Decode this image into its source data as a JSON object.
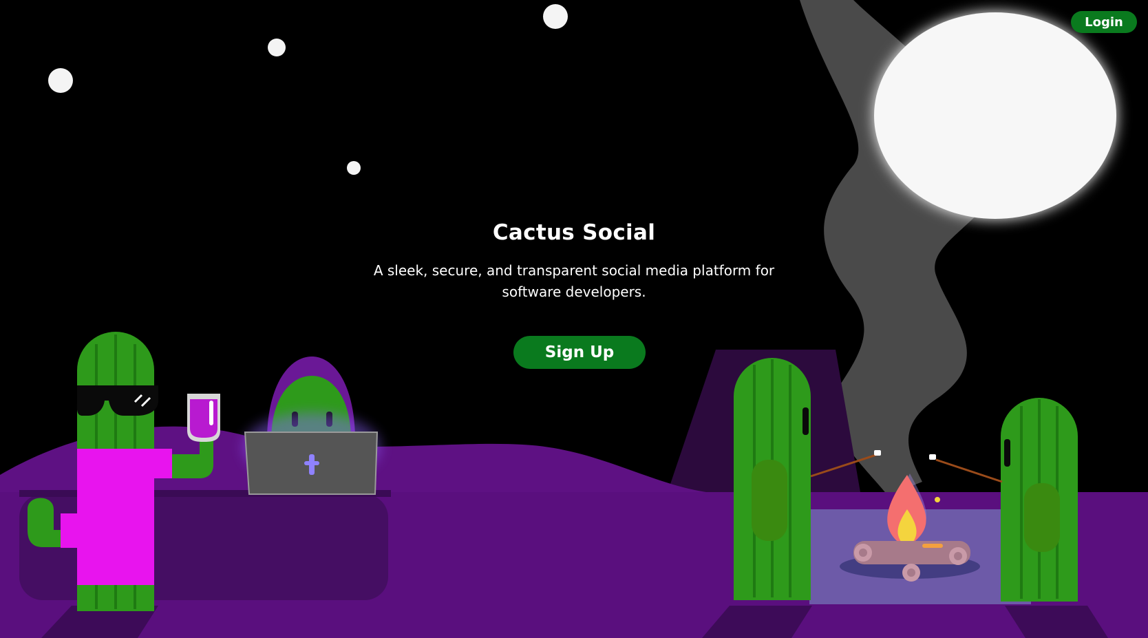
{
  "header": {
    "login_label": "Login"
  },
  "hero": {
    "title": "Cactus Social",
    "subtitle": "A sleek, secure, and transparent social media platform for software developers.",
    "signup_label": "Sign Up"
  },
  "colors": {
    "background": "#000000",
    "ground": "#5e1183",
    "ground_dark": "#450e63",
    "accent_green": "#0a7a1e",
    "cactus_green": "#2e9a1b",
    "shirt_pink": "#e814ee",
    "moon": "#f7f7f7",
    "smoke": "#4a4a4a"
  },
  "illustration": {
    "characters": [
      "cool-cactus-with-sunglasses",
      "hooded-cactus-with-laptop",
      "left-campfire-cactus",
      "right-campfire-cactus"
    ],
    "props": [
      "drink-glass",
      "laptop",
      "campfire",
      "marshmallow-sticks"
    ]
  }
}
